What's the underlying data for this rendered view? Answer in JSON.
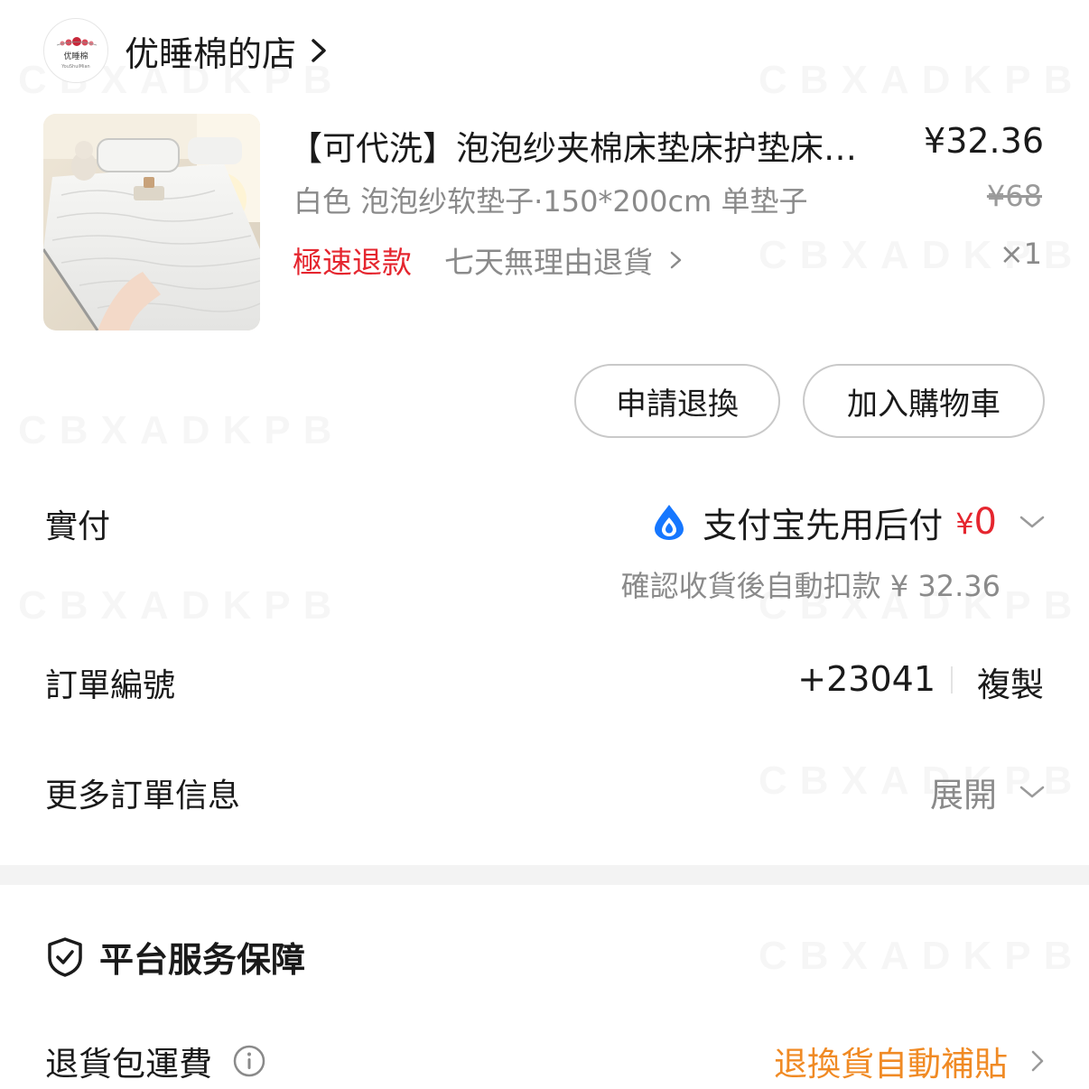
{
  "shop": {
    "name": "优睡棉的店",
    "logo_text": "优睡棉",
    "logo_subtext": "YouShuiMian"
  },
  "product": {
    "title": "【可代洗】泡泡纱夹棉床垫床护垫床…",
    "price": "¥32.36",
    "spec": "白色 泡泡纱软垫子·150*200cm 单垫子",
    "original_price": "¥68",
    "refund_fast": "極速退款",
    "refund_policy": "七天無理由退貨",
    "quantity": "×1"
  },
  "actions": {
    "refund_exchange": "申請退換",
    "add_to_cart": "加入購物車"
  },
  "payment": {
    "label": "實付",
    "method": "支付宝先用后付",
    "currency": "¥",
    "amount": "0",
    "auto_deduct": "確認收貨後自動扣款 ¥ 32.36"
  },
  "order": {
    "label": "訂單編號",
    "number_visible": "+23041",
    "copy": "複製"
  },
  "more_info": {
    "label": "更多訂單信息",
    "expand": "展開"
  },
  "service": {
    "title": "平台服务保障",
    "shipping_label": "退貨包運費",
    "shipping_status": "退換貨自動補貼"
  },
  "watermark": "CBXADKPB",
  "colors": {
    "red": "#e5262f",
    "orange": "#f08a24",
    "gray": "#8a8a8a",
    "alipay_blue": "#1677ff"
  }
}
